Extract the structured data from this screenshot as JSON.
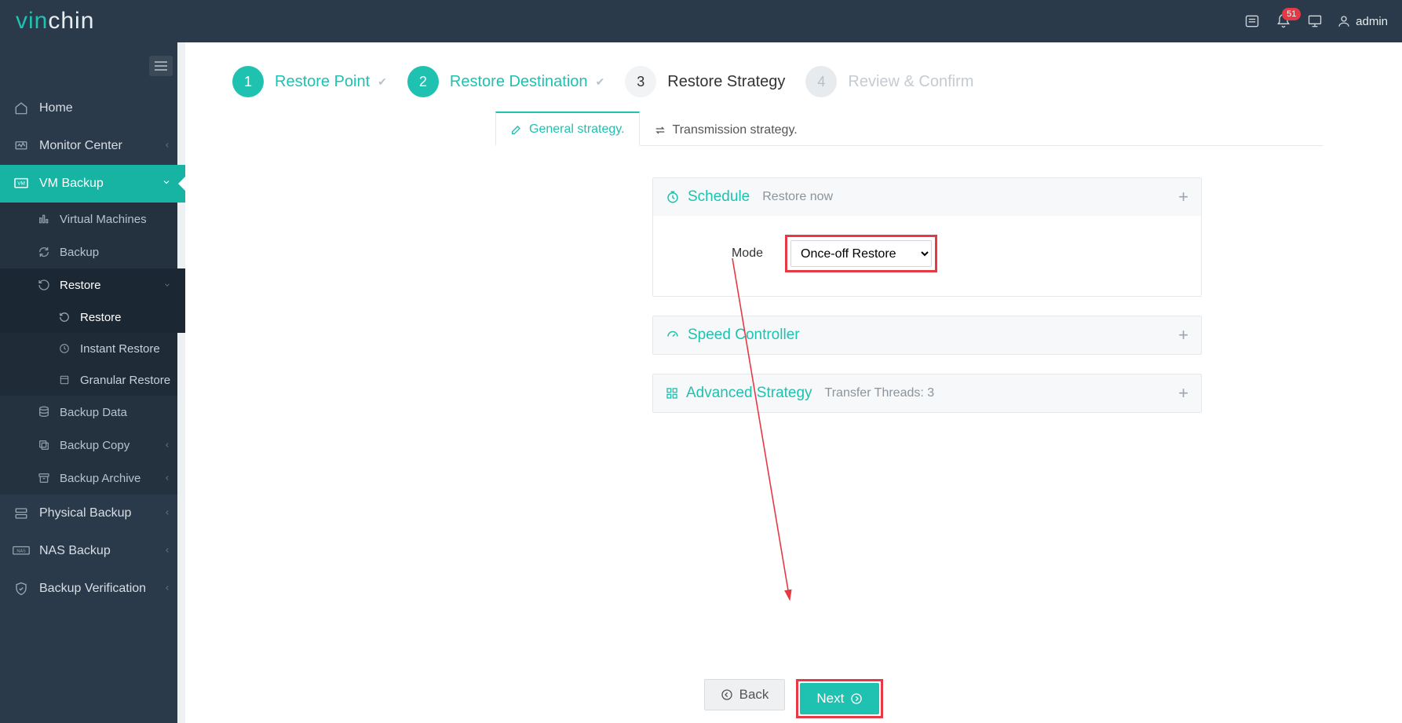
{
  "brand": {
    "part1": "vin",
    "part2": "chin"
  },
  "header": {
    "notification_count": "51",
    "username": "admin"
  },
  "sidebar": {
    "items": [
      {
        "label": "Home"
      },
      {
        "label": "Monitor Center"
      },
      {
        "label": "VM Backup"
      },
      {
        "label": "Physical Backup"
      },
      {
        "label": "NAS Backup"
      },
      {
        "label": "Backup Verification"
      }
    ],
    "vm_backup_children": [
      {
        "label": "Virtual Machines"
      },
      {
        "label": "Backup"
      },
      {
        "label": "Restore"
      },
      {
        "label": "Backup Data"
      },
      {
        "label": "Backup Copy"
      },
      {
        "label": "Backup Archive"
      }
    ],
    "restore_children": [
      {
        "label": "Restore"
      },
      {
        "label": "Instant Restore"
      },
      {
        "label": "Granular Restore"
      }
    ]
  },
  "wizard": {
    "steps": [
      {
        "num": "1",
        "label": "Restore Point"
      },
      {
        "num": "2",
        "label": "Restore Destination"
      },
      {
        "num": "3",
        "label": "Restore Strategy"
      },
      {
        "num": "4",
        "label": "Review & Confirm"
      }
    ]
  },
  "tabs": {
    "general": "General strategy.",
    "transmission": "Transmission strategy."
  },
  "strategy": {
    "schedule": {
      "title": "Schedule",
      "meta": "Restore now",
      "mode_label": "Mode",
      "mode_value": "Once-off Restore"
    },
    "speed": {
      "title": "Speed Controller"
    },
    "advanced": {
      "title": "Advanced Strategy",
      "meta": "Transfer Threads: 3"
    }
  },
  "footer": {
    "back": "Back",
    "next": "Next"
  }
}
